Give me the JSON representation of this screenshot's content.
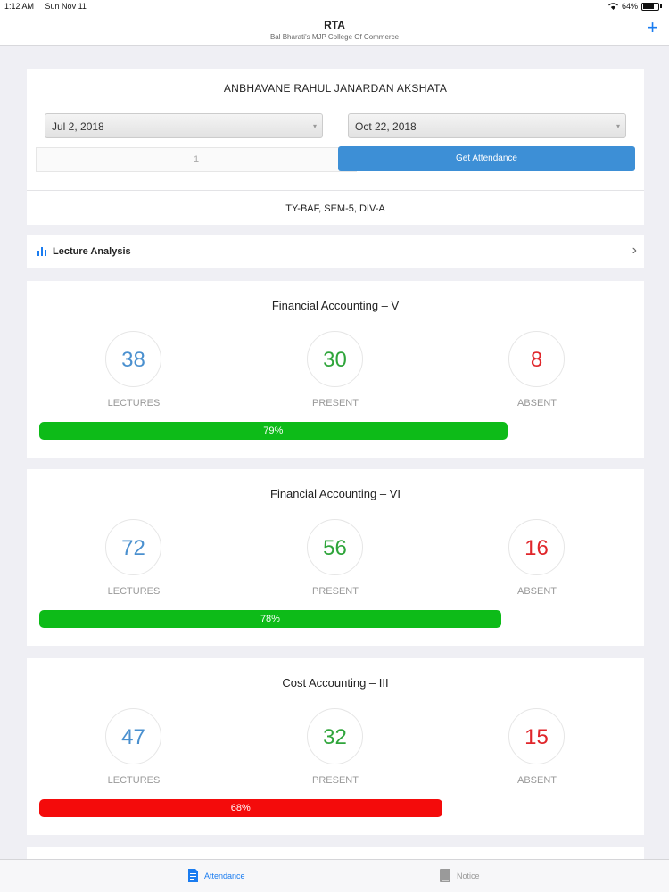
{
  "status_bar": {
    "time": "1:12 AM",
    "date": "Sun Nov 11",
    "battery": "64%"
  },
  "nav": {
    "title": "RTA",
    "subtitle": "Bal Bharati's MJP College Of Commerce",
    "add_icon": "plus-icon"
  },
  "student": {
    "name": "ANBHAVANE RAHUL JANARDAN AKSHATA",
    "from_date": "Jul 2, 2018",
    "to_date": "Oct 22, 2018",
    "count_value": "1",
    "get_button_label": "Get Attendance",
    "class_info": "TY-BAF,  SEM-5,  DIV-A"
  },
  "analysis": {
    "label": "Lecture Analysis",
    "icon": "bar-chart-icon"
  },
  "labels": {
    "lectures": "LECTURES",
    "present": "PRESENT",
    "absent": "ABSENT"
  },
  "subjects": [
    {
      "title": "Financial Accounting – V",
      "lectures": "38",
      "present": "30",
      "absent": "8",
      "percent": "79%",
      "fill": 0.79,
      "bar_color": "#0dbb18"
    },
    {
      "title": "Financial Accounting – VI",
      "lectures": "72",
      "present": "56",
      "absent": "16",
      "percent": "78%",
      "fill": 0.78,
      "bar_color": "#0dbb18"
    },
    {
      "title": "Cost Accounting – III",
      "lectures": "47",
      "present": "32",
      "absent": "15",
      "percent": "68%",
      "fill": 0.68,
      "bar_color": "#f40b0b"
    }
  ],
  "tabs": [
    {
      "label": "Attendance",
      "icon": "document-icon",
      "active": true
    },
    {
      "label": "Notice",
      "icon": "notice-icon",
      "active": false
    }
  ],
  "colors": {
    "accent": "#1a7cf0",
    "button": "#3d8fd6",
    "lectures": "#4a90cf",
    "present": "#2fa53b",
    "absent": "#e0262b"
  }
}
